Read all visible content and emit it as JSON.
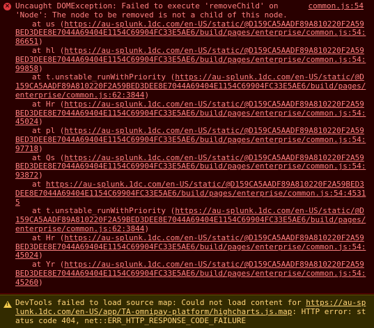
{
  "error": {
    "icon": "error-x-icon",
    "source_link": "common.js:54",
    "message_line1": "Uncaught DOMException: Failed to execute 'removeChild' on",
    "message_line2": "'Node': The node to be removed is not a child of this node.",
    "frames": [
      {
        "prefix": "at us (",
        "url": "https://au-splunk.1dc.com/en-US/static/@D159CA5AADF89A810220F2A59BED3DEE8E7044A69404E1154C69904FC33E5AE6/build/pages/enterprise/common.js:54:86651",
        "suffix": ")"
      },
      {
        "prefix": "at hl (",
        "url": "https://au-splunk.1dc.com/en-US/static/@D159CA5AADF89A810220F2A59BED3DEE8E7044A69404E1154C69904FC33E5AE6/build/pages/enterprise/common.js:54:99858",
        "suffix": ")"
      },
      {
        "prefix": "at t.unstable_runWithPriority (",
        "url": "https://au-splunk.1dc.com/en-US/static/@D159CA5AADF89A810220F2A59BED3DEE8E7044A69404E1154C69904FC33E5AE6/build/pages/enterprise/common.js:62:3844",
        "suffix": ")"
      },
      {
        "prefix": "at Hr (",
        "url": "https://au-splunk.1dc.com/en-US/static/@D159CA5AADF89A810220F2A59BED3DEE8E7044A69404E1154C69904FC33E5AE6/build/pages/enterprise/common.js:54:45024",
        "suffix": ")"
      },
      {
        "prefix": "at pl (",
        "url": "https://au-splunk.1dc.com/en-US/static/@D159CA5AADF89A810220F2A59BED3DEE8E7044A69404E1154C69904FC33E5AE6/build/pages/enterprise/common.js:54:97718",
        "suffix": ")"
      },
      {
        "prefix": "at Qs (",
        "url": "https://au-splunk.1dc.com/en-US/static/@D159CA5AADF89A810220F2A59BED3DEE8E7044A69404E1154C69904FC33E5AE6/build/pages/enterprise/common.js:54:93872",
        "suffix": ")"
      },
      {
        "prefix": "at ",
        "url": "https://au-splunk.1dc.com/en-US/static/@D159CA5AADF89A810220F2A59BED3DEE8E7044A69404E1154C69904FC33E5AE6/build/pages/enterprise/common.js:54:45315",
        "suffix": ""
      },
      {
        "prefix": "at t.unstable_runWithPriority (",
        "url": "https://au-splunk.1dc.com/en-US/static/@D159CA5AADF89A810220F2A59BED3DEE8E7044A69404E1154C69904FC33E5AE6/build/pages/enterprise/common.js:62:3844",
        "suffix": ")"
      },
      {
        "prefix": "at Hr (",
        "url": "https://au-splunk.1dc.com/en-US/static/@D159CA5AADF89A810220F2A59BED3DEE8E7044A69404E1154C69904FC33E5AE6/build/pages/enterprise/common.js:54:45024",
        "suffix": ")"
      },
      {
        "prefix": "at Yr (",
        "url": "https://au-splunk.1dc.com/en-US/static/@D159CA5AADF89A810220F2A59BED3DEE8E7044A69404E1154C69904FC33E5AE6/build/pages/enterprise/common.js:54:45260",
        "suffix": ")"
      }
    ]
  },
  "warning": {
    "icon": "warning-triangle-icon",
    "prefix": "DevTools failed to load source map: Could not load content for ",
    "url": "https://au-splunk.1dc.com/en-US/app/TA-omnipay-platform/highcharts.js.map",
    "suffix": ": HTTP error: status code 404, net::ERR_HTTP_RESPONSE_CODE_FAILURE"
  },
  "colors": {
    "error_bg": "#290000",
    "error_text": "#ff8080",
    "warning_bg": "#332b00",
    "warning_text": "#ffd479"
  }
}
